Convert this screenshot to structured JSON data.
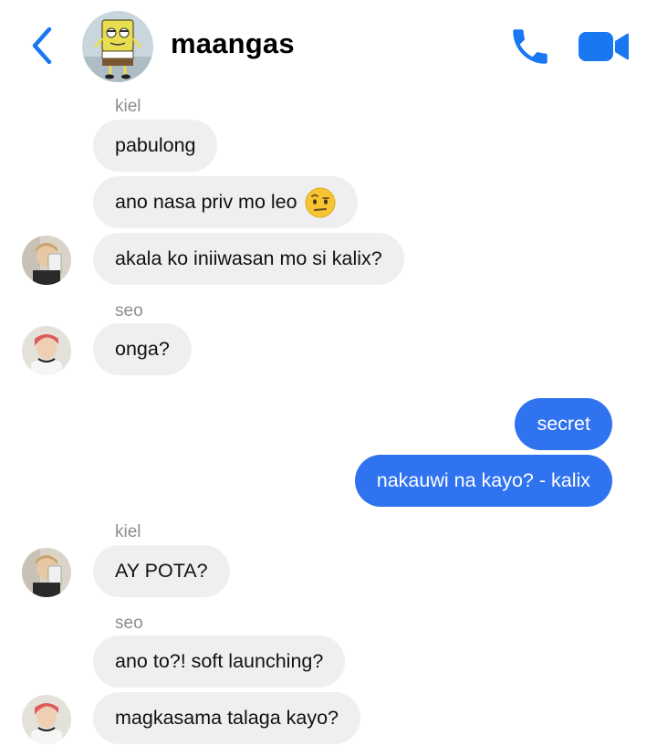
{
  "header": {
    "title": "maangas",
    "back_icon": "chevron-left-icon",
    "call_icon": "phone-icon",
    "video_icon": "video-camera-icon",
    "accent_color": "#1a77f2"
  },
  "messages": [
    {
      "sender": "kiel"
    },
    {
      "text": "pabulong",
      "direction": "in"
    },
    {
      "text": "ano nasa priv mo leo",
      "direction": "in",
      "emoji": "raised-eyebrow-emoji"
    },
    {
      "text": "akala ko iniiwasan mo si kalix?",
      "direction": "in"
    },
    {
      "sender": "seo"
    },
    {
      "text": "onga?",
      "direction": "in"
    },
    {
      "text": "secret",
      "direction": "out"
    },
    {
      "text": "nakauwi na kayo? - kalix",
      "direction": "out"
    },
    {
      "sender": "kiel"
    },
    {
      "text": "AY POTA?",
      "direction": "in"
    },
    {
      "sender": "seo"
    },
    {
      "text": "ano to?! soft launching?",
      "direction": "in"
    },
    {
      "text": "magkasama talaga kayo?",
      "direction": "in"
    }
  ],
  "colors": {
    "incoming_bubble": "#efeff1",
    "outgoing_bubble": "#2f73f0",
    "sender_label": "#8e8e93"
  }
}
